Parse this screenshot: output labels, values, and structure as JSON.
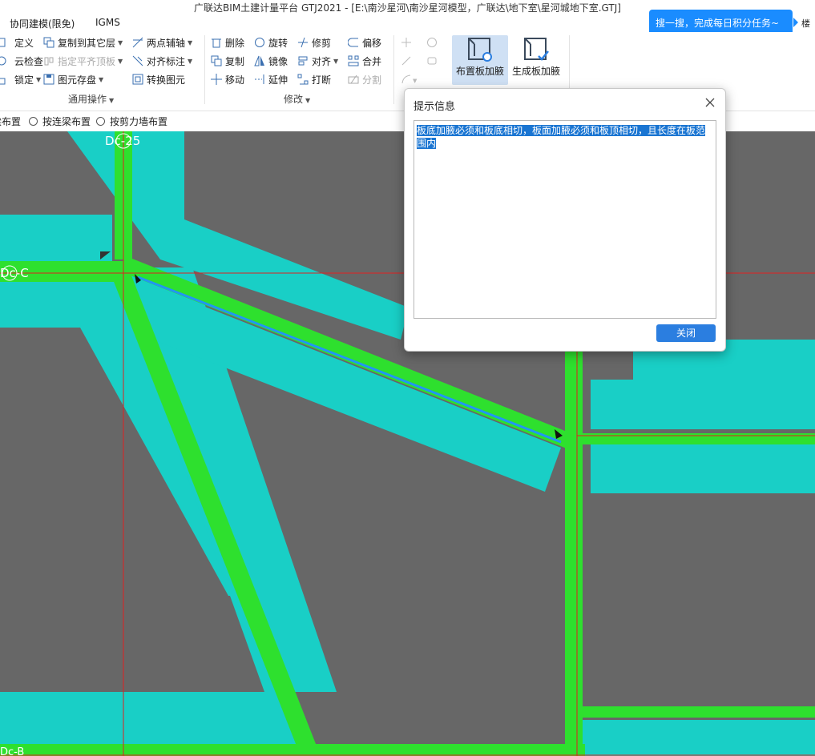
{
  "window": {
    "title": "广联达BIM土建计量平台 GTJ2021 - [E:\\南沙星河\\南沙星河模型，广联达\\地下室\\星河城地下室.GTJ]"
  },
  "tabs": [
    "协同建模(限免)",
    "IGMS"
  ],
  "notification": {
    "text": "搜一搜，完成每日积分任务~"
  },
  "floor_label": "楼层",
  "ribbon": {
    "general": {
      "label": "通用操作",
      "col1": [
        "定义",
        "云检查",
        "锁定"
      ],
      "col2": [
        "复制到其它层",
        "指定平齐顶板",
        "图元存盘"
      ],
      "col3": [
        "两点辅轴",
        "对齐标注",
        "转换图元"
      ]
    },
    "modify": {
      "label": "修改",
      "col1": [
        "删除",
        "复制",
        "移动"
      ],
      "col2": [
        "旋转",
        "镜像",
        "延伸"
      ],
      "col3": [
        "修剪",
        "对齐",
        "打断"
      ],
      "col4": [
        "偏移",
        "合并",
        "分割"
      ]
    },
    "haunch": {
      "place": "布置板加腋",
      "generate": "生成板加腋"
    }
  },
  "options": [
    "梁布置",
    "按连梁布置",
    "按剪力墙布置"
  ],
  "canvas": {
    "axes": [
      "Dc-25",
      "Dc-C",
      "Dc-B"
    ]
  },
  "dialog": {
    "title": "提示信息",
    "message": "板底加腋必须和板底相切，板面加腋必须和板顶相切，且长度在板范围内",
    "close_label": "关闭"
  }
}
